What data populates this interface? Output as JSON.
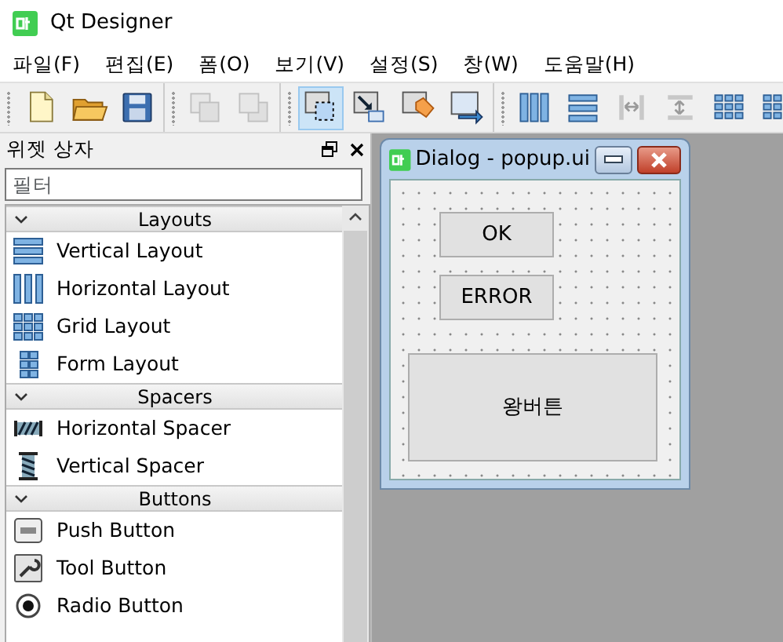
{
  "app": {
    "title": "Qt Designer"
  },
  "menu": [
    {
      "label": "파일(F)"
    },
    {
      "label": "편집(E)"
    },
    {
      "label": "폼(O)"
    },
    {
      "label": "보기(V)"
    },
    {
      "label": "설정(S)"
    },
    {
      "label": "창(W)"
    },
    {
      "label": "도움말(H)"
    }
  ],
  "toolbar": [
    [
      {
        "selected": false,
        "disabled": false
      },
      {
        "selected": false,
        "disabled": false
      },
      {
        "selected": false,
        "disabled": false
      }
    ],
    [
      {
        "selected": false,
        "disabled": true
      },
      {
        "selected": false,
        "disabled": true
      }
    ],
    [
      {
        "selected": true,
        "disabled": false
      },
      {
        "selected": false,
        "disabled": false
      },
      {
        "selected": false,
        "disabled": false
      },
      {
        "selected": false,
        "disabled": false
      }
    ],
    [
      {
        "selected": false,
        "disabled": false
      },
      {
        "selected": false,
        "disabled": false
      },
      {
        "selected": false,
        "disabled": true
      },
      {
        "selected": false,
        "disabled": true
      },
      {
        "selected": false,
        "disabled": false
      },
      {
        "selected": false,
        "disabled": false
      }
    ]
  ],
  "widget_box": {
    "title": "위젯 상자",
    "filter": {
      "placeholder": "필터"
    },
    "sections": [
      {
        "title": "Layouts",
        "expanded": true,
        "items": [
          {
            "label": "Vertical Layout"
          },
          {
            "label": "Horizontal Layout"
          },
          {
            "label": "Grid Layout"
          },
          {
            "label": "Form Layout"
          }
        ]
      },
      {
        "title": "Spacers",
        "expanded": true,
        "items": [
          {
            "label": "Horizontal Spacer"
          },
          {
            "label": "Vertical Spacer"
          }
        ]
      },
      {
        "title": "Buttons",
        "expanded": true,
        "items": [
          {
            "label": "Push Button"
          },
          {
            "label": "Tool Button"
          },
          {
            "label": "Radio Button"
          }
        ]
      }
    ]
  },
  "dialog": {
    "title": "Dialog - popup.ui",
    "widgets": [
      {
        "text": "OK"
      },
      {
        "text": "ERROR"
      },
      {
        "text": "왕버튼"
      }
    ]
  }
}
